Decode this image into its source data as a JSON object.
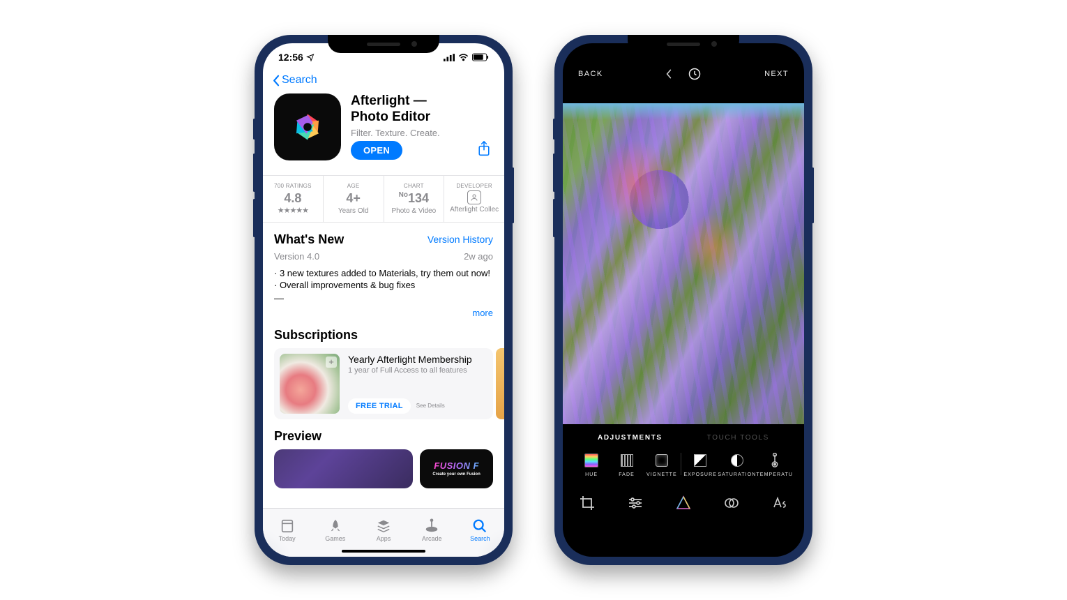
{
  "phone1": {
    "status": {
      "time": "12:56"
    },
    "nav": {
      "back": "Search"
    },
    "app": {
      "name_line1": "Afterlight —",
      "name_line2": "Photo Editor",
      "tagline": "Filter. Texture. Create.",
      "open": "OPEN"
    },
    "stats": {
      "ratings_label": "700 RATINGS",
      "ratings_value": "4.8",
      "age_label": "AGE",
      "age_value": "4+",
      "age_sub": "Years Old",
      "chart_label": "CHART",
      "chart_prefix": "No",
      "chart_value": "134",
      "chart_sub": "Photo & Video",
      "dev_label": "DEVELOPER",
      "dev_sub": "Afterlight Collec"
    },
    "whatsnew": {
      "title": "What's New",
      "history": "Version History",
      "version": "Version 4.0",
      "ago": "2w ago",
      "note1": "· 3 new textures added to Materials, try them out now!",
      "note2": "· Overall improvements & bug fixes",
      "dash": "—",
      "more": "more"
    },
    "subs": {
      "title": "Subscriptions",
      "item_title": "Yearly Afterlight Membership",
      "item_desc": "1 year of Full Access to all features",
      "trial": "FREE TRIAL",
      "see": "See Details"
    },
    "preview": {
      "title": "Preview",
      "fusion": "FUSION F",
      "fusion_sub": "Create your own Fusion"
    },
    "tabs": {
      "today": "Today",
      "games": "Games",
      "apps": "Apps",
      "arcade": "Arcade",
      "search": "Search"
    }
  },
  "phone2": {
    "top": {
      "back": "BACK",
      "next": "NEXT"
    },
    "tabs": {
      "adjustments": "ADJUSTMENTS",
      "touch": "TOUCH TOOLS"
    },
    "tools": {
      "hue": "HUE",
      "fade": "FADE",
      "vignette": "VIGNETTE",
      "exposure": "EXPOSURE",
      "saturation": "SATURATION",
      "temperature": "TEMPERATU"
    }
  }
}
